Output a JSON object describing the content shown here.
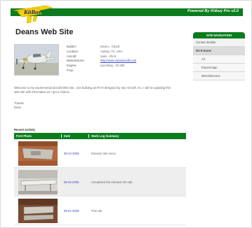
{
  "header": {
    "powered_by": "Powered By Kitbuy Pro v2.0",
    "logo_text": "Kitbuy"
  },
  "site_title": "Deans Web Site",
  "details": [
    {
      "label": "Builder:",
      "value": "Dean L. Chard"
    },
    {
      "label": "Location:",
      "value": "Aubrey, TX, USA"
    },
    {
      "label": "Aircraft:",
      "value": "Vans - RV-9"
    },
    {
      "label": "Manufacturer:",
      "value": "http://www.vansaircraft.com",
      "link": true
    },
    {
      "label": "Engine:",
      "value": "Lycoming - IO-360"
    },
    {
      "label": "Prop:",
      "value": ""
    }
  ],
  "welcome": "Welcome to my experimental aircraft Web site. I am building an RV-9 designed by Van Aircraft, Inc. I will be updating this web site with information as I get a chance.",
  "thanks": "Thanks,",
  "signature": "Dean",
  "recent": {
    "title": "Recent Activity",
    "columns": [
      "First Photo",
      "Date",
      "Work Log Summary"
    ],
    "rows": [
      {
        "date": "06-12-2006",
        "summary": "Elevator trim servo"
      },
      {
        "date": "06-02-2006",
        "summary": "Completed the elevator trim tab"
      },
      {
        "date": "06-01-2006",
        "summary": "Trim tab"
      }
    ]
  },
  "nav": {
    "title": "SITE NAVIGATION",
    "items": [
      {
        "label": "Contact Builder",
        "level": 0
      },
      {
        "label": "RV-9 Home",
        "level": 0,
        "active": true
      },
      {
        "label": "All",
        "level": 1
      },
      {
        "label": "Empennage",
        "level": 1
      },
      {
        "label": "Miscellaneous",
        "level": 1
      }
    ]
  },
  "colors": {
    "accent_green": "#0b7d1e",
    "logo_yellow": "#f5d20a",
    "link_blue": "#3344cc"
  }
}
